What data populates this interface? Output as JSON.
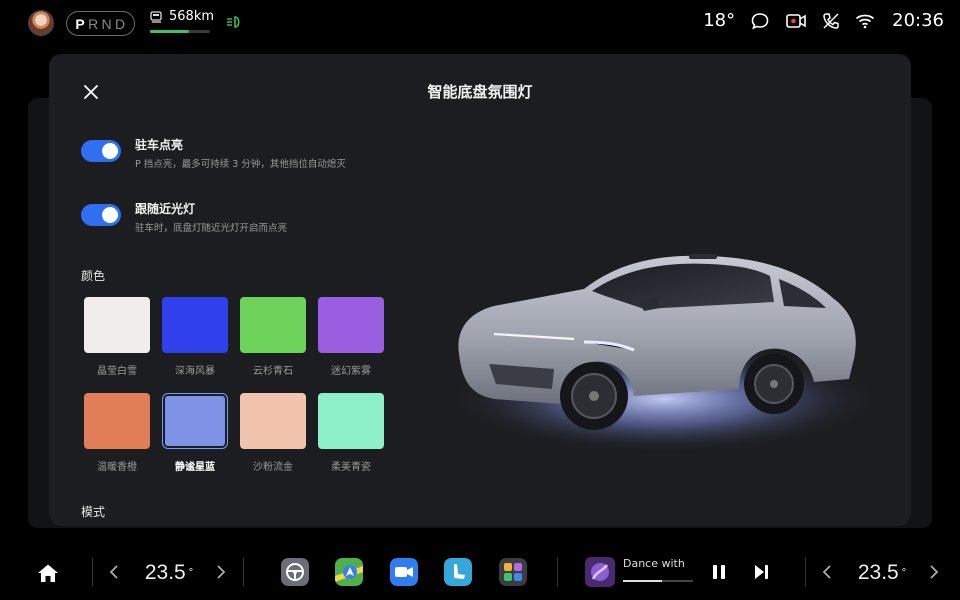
{
  "status": {
    "gears": [
      "P",
      "R",
      "N",
      "D"
    ],
    "active_gear": "P",
    "range": "568km",
    "range_fraction": 0.65,
    "temperature": "18°",
    "time": "20:36",
    "accent": "#38c35b"
  },
  "modal": {
    "title": "智能底盘氛围灯",
    "settings": [
      {
        "name": "驻车点亮",
        "desc": "P 挡点亮，最多可持续 3 分钟，其他挡位自动熄灭",
        "on": true
      },
      {
        "name": "跟随近光灯",
        "desc": "驻车时，底盘灯随近光灯开启而点亮",
        "on": true
      }
    ],
    "color_section": "颜色",
    "colors": [
      {
        "label": "晶莹白雪",
        "hex": "#f2eded"
      },
      {
        "label": "深海风暴",
        "hex": "#3040ec"
      },
      {
        "label": "云杉青石",
        "hex": "#6dd25a"
      },
      {
        "label": "迷幻紫雾",
        "hex": "#9a5ee0"
      },
      {
        "label": "温暖香橙",
        "hex": "#e07e58"
      },
      {
        "label": "静谧星蓝",
        "hex": "#7f93e6",
        "selected": true
      },
      {
        "label": "沙粉流金",
        "hex": "#f2c3ad"
      },
      {
        "label": "柔美青瓷",
        "hex": "#8ef0c8"
      }
    ],
    "mode_section": "模式"
  },
  "dock": {
    "left_temp": "23.5",
    "right_temp": "23.5",
    "degree": "°",
    "media_title": "Dance with",
    "media_progress": 0.55
  }
}
